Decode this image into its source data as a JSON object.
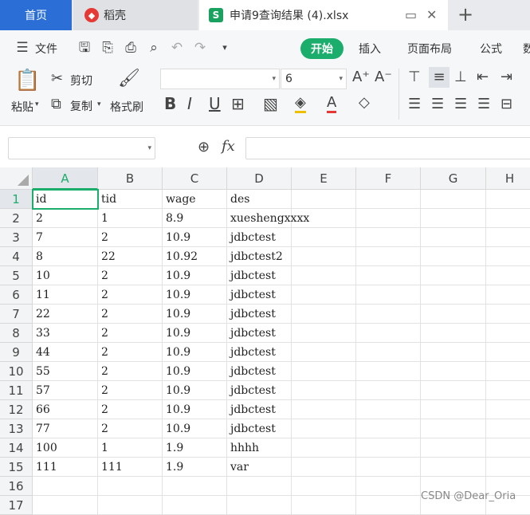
{
  "tabs": {
    "home": "首页",
    "daoke": "稻壳",
    "file": "申请9查询结果 (4).xlsx"
  },
  "menu": {
    "file": "文件",
    "start": "开始",
    "insert": "插入",
    "page_layout": "页面布局",
    "formula": "公式"
  },
  "ribbon": {
    "paste": "粘贴",
    "cut": "剪切",
    "copy": "复制",
    "format_painter": "格式刷",
    "font_size": "6"
  },
  "formula_bar": {
    "fx": "fx"
  },
  "sheet": {
    "columns": [
      "A",
      "B",
      "C",
      "D",
      "E",
      "F",
      "G",
      "H"
    ],
    "row_numbers": [
      "1",
      "2",
      "3",
      "4",
      "5",
      "6",
      "7",
      "8",
      "9",
      "10",
      "11",
      "12",
      "13",
      "14",
      "15",
      "16",
      "17"
    ],
    "rows": [
      [
        "id",
        "tid",
        "wage",
        "des"
      ],
      [
        "2",
        "1",
        "8.9",
        "xueshengxxxx"
      ],
      [
        "7",
        "2",
        "10.9",
        "jdbctest"
      ],
      [
        "8",
        "22",
        "10.92",
        "jdbctest2"
      ],
      [
        "10",
        "2",
        "10.9",
        "jdbctest"
      ],
      [
        "11",
        "2",
        "10.9",
        "jdbctest"
      ],
      [
        "22",
        "2",
        "10.9",
        "jdbctest"
      ],
      [
        "33",
        "2",
        "10.9",
        "jdbctest"
      ],
      [
        "44",
        "2",
        "10.9",
        "jdbctest"
      ],
      [
        "55",
        "2",
        "10.9",
        "jdbctest"
      ],
      [
        "57",
        "2",
        "10.9",
        "jdbctest"
      ],
      [
        "66",
        "2",
        "10.9",
        "jdbctest"
      ],
      [
        "77",
        "2",
        "10.9",
        "jdbctest"
      ],
      [
        "100",
        "1",
        "1.9",
        "hhhh"
      ],
      [
        "111",
        "111",
        "1.9",
        "var"
      ]
    ]
  },
  "watermark": "CSDN @Dear_Oria",
  "colors": {
    "accent": "#1aad6b",
    "home_tab": "#2b6fd6"
  }
}
